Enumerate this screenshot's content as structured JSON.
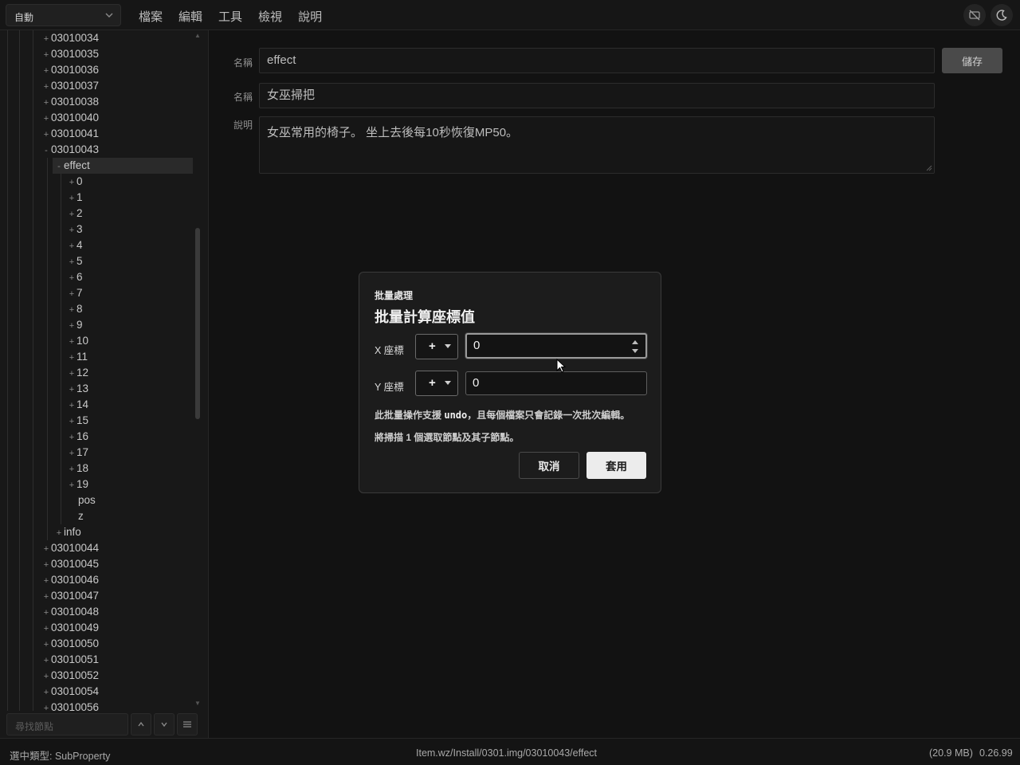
{
  "topbar": {
    "mode": "自動",
    "menu": [
      "檔案",
      "編輯",
      "工具",
      "檢視",
      "說明"
    ],
    "icons": [
      "visibility-off-icon",
      "moon-icon"
    ]
  },
  "tree": {
    "rows": [
      {
        "t": "+",
        "label": "03010034",
        "d": 0
      },
      {
        "t": "+",
        "label": "03010035",
        "d": 0
      },
      {
        "t": "+",
        "label": "03010036",
        "d": 0
      },
      {
        "t": "+",
        "label": "03010037",
        "d": 0
      },
      {
        "t": "+",
        "label": "03010038",
        "d": 0
      },
      {
        "t": "+",
        "label": "03010040",
        "d": 0
      },
      {
        "t": "+",
        "label": "03010041",
        "d": 0
      },
      {
        "t": "-",
        "label": "03010043",
        "d": 0
      },
      {
        "t": "-",
        "label": "effect",
        "d": 1,
        "sel": true
      },
      {
        "t": "+",
        "label": "0",
        "d": 2
      },
      {
        "t": "+",
        "label": "1",
        "d": 2
      },
      {
        "t": "+",
        "label": "2",
        "d": 2
      },
      {
        "t": "+",
        "label": "3",
        "d": 2
      },
      {
        "t": "+",
        "label": "4",
        "d": 2
      },
      {
        "t": "+",
        "label": "5",
        "d": 2
      },
      {
        "t": "+",
        "label": "6",
        "d": 2
      },
      {
        "t": "+",
        "label": "7",
        "d": 2
      },
      {
        "t": "+",
        "label": "8",
        "d": 2
      },
      {
        "t": "+",
        "label": "9",
        "d": 2
      },
      {
        "t": "+",
        "label": "10",
        "d": 2
      },
      {
        "t": "+",
        "label": "11",
        "d": 2
      },
      {
        "t": "+",
        "label": "12",
        "d": 2
      },
      {
        "t": "+",
        "label": "13",
        "d": 2
      },
      {
        "t": "+",
        "label": "14",
        "d": 2
      },
      {
        "t": "+",
        "label": "15",
        "d": 2
      },
      {
        "t": "+",
        "label": "16",
        "d": 2
      },
      {
        "t": "+",
        "label": "17",
        "d": 2
      },
      {
        "t": "+",
        "label": "18",
        "d": 2
      },
      {
        "t": "+",
        "label": "19",
        "d": 2
      },
      {
        "t": "",
        "label": "pos",
        "d": 2
      },
      {
        "t": "",
        "label": "z",
        "d": 2
      },
      {
        "t": "+",
        "label": "info",
        "d": 1
      },
      {
        "t": "+",
        "label": "03010044",
        "d": 0
      },
      {
        "t": "+",
        "label": "03010045",
        "d": 0
      },
      {
        "t": "+",
        "label": "03010046",
        "d": 0
      },
      {
        "t": "+",
        "label": "03010047",
        "d": 0
      },
      {
        "t": "+",
        "label": "03010048",
        "d": 0
      },
      {
        "t": "+",
        "label": "03010049",
        "d": 0
      },
      {
        "t": "+",
        "label": "03010050",
        "d": 0
      },
      {
        "t": "+",
        "label": "03010051",
        "d": 0
      },
      {
        "t": "+",
        "label": "03010052",
        "d": 0
      },
      {
        "t": "+",
        "label": "03010054",
        "d": 0
      },
      {
        "t": "+",
        "label": "03010056",
        "d": 0
      }
    ],
    "search_placeholder": "尋找節點"
  },
  "form": {
    "name_label": "名稱",
    "name_value": "effect",
    "save_label": "儲存",
    "title_label": "名稱",
    "title_value": "女巫掃把",
    "desc_label": "說明",
    "desc_value": "女巫常用的椅子。 坐上去後每10秒恢復MP50。"
  },
  "dialog": {
    "subtitle": "批量處理",
    "title": "批量計算座標值",
    "x_label": "X 座標",
    "y_label": "Y 座標",
    "x_op": "+",
    "y_op": "+",
    "x_value": "0",
    "y_value": "0",
    "note_prefix": "此批量操作支援",
    "note_keyword": "undo",
    "note_suffix": "，且每個檔案只會記錄一次批次編輯。",
    "note2": "將掃描 1 個選取節點及其子節點。",
    "cancel": "取消",
    "apply": "套用"
  },
  "status": {
    "type": "選中類型: SubProperty",
    "path": "Item.wz/Install/0301.img/03010043/effect",
    "size": "(20.9 MB)",
    "version": "0.26.99"
  }
}
